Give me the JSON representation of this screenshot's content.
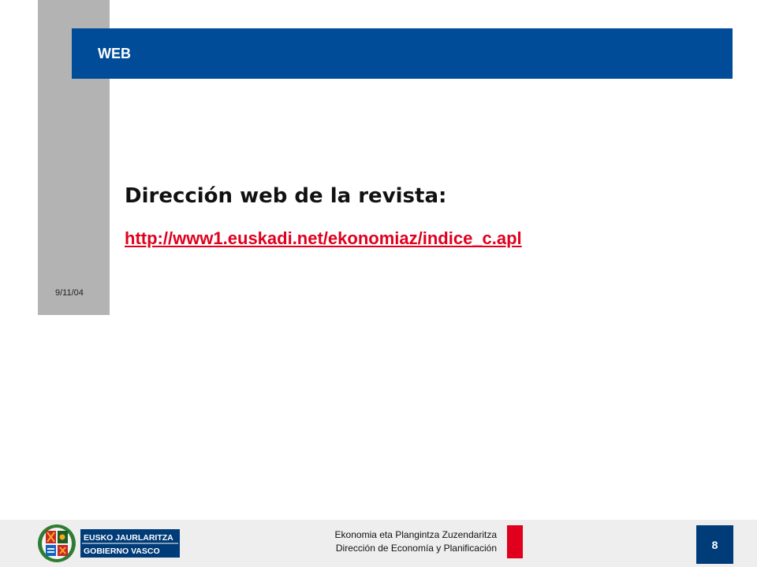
{
  "slide": {
    "title": "WEB",
    "date": "9/11/04",
    "heading": "Dirección web de la revista:",
    "link": "http://www1.euskadi.net/ekonomiaz/indice_c.apl"
  },
  "footer": {
    "logo_line1": "EUSKO JAURLARITZA",
    "logo_line2": "GOBIERNO VASCO",
    "department_eu": "Ekonomia eta Plangintza Zuzendaritza",
    "department_es": "Dirección de Economía y Planificación",
    "page_number": "8"
  },
  "colors": {
    "title_band": "#004c98",
    "link": "#e0001e",
    "accent_red": "#e0001e",
    "page_box": "#003c78"
  }
}
